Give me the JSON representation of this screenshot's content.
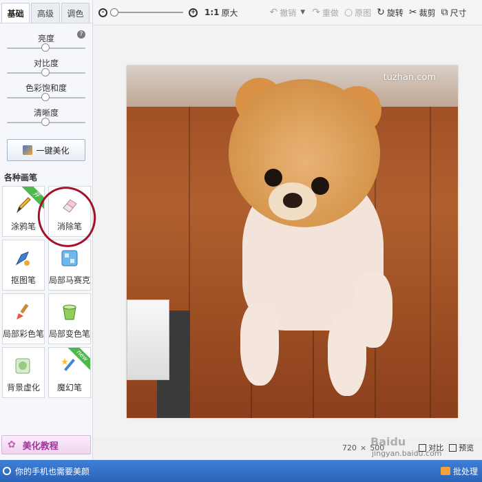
{
  "tabs": [
    "基础",
    "高级",
    "调色"
  ],
  "adjust": {
    "help": "?",
    "sliders": [
      {
        "label": "亮度",
        "value": 0.5
      },
      {
        "label": "对比度",
        "value": 0.5
      },
      {
        "label": "色彩饱和度",
        "value": 0.5
      },
      {
        "label": "清晰度",
        "value": 0.5
      }
    ],
    "one_click_label": "一键美化"
  },
  "brushes": {
    "title": "各种画笔",
    "items": [
      {
        "label": "涂鸦笔",
        "badge": "开"
      },
      {
        "label": "消除笔"
      },
      {
        "label": "抠图笔"
      },
      {
        "label": "局部马赛克"
      },
      {
        "label": "局部彩色笔"
      },
      {
        "label": "局部变色笔"
      },
      {
        "label": "背景虚化"
      },
      {
        "label": "魔幻笔",
        "badge": "new"
      }
    ]
  },
  "tutorial": {
    "label": "美化教程"
  },
  "toolbar": {
    "zoom_in": "+",
    "zoom_out": "-",
    "zoom_value": 0,
    "one_to_one": "1:1",
    "original_size": "原大",
    "undo": "撤销",
    "redo": "重做",
    "original": "原图",
    "rotate": "旋转",
    "crop": "裁剪",
    "size": "尺寸"
  },
  "photo": {
    "watermark": "tuzhan.com"
  },
  "info": {
    "width": "720",
    "times": "×",
    "height": "500",
    "compare": "对比",
    "preview": "预览"
  },
  "statusbar": {
    "message": "你的手机也需要美颜",
    "batch": "批处理"
  },
  "watermarks": {
    "baidu": "Baidu",
    "jingyan": "jingyan.baidu.com"
  }
}
